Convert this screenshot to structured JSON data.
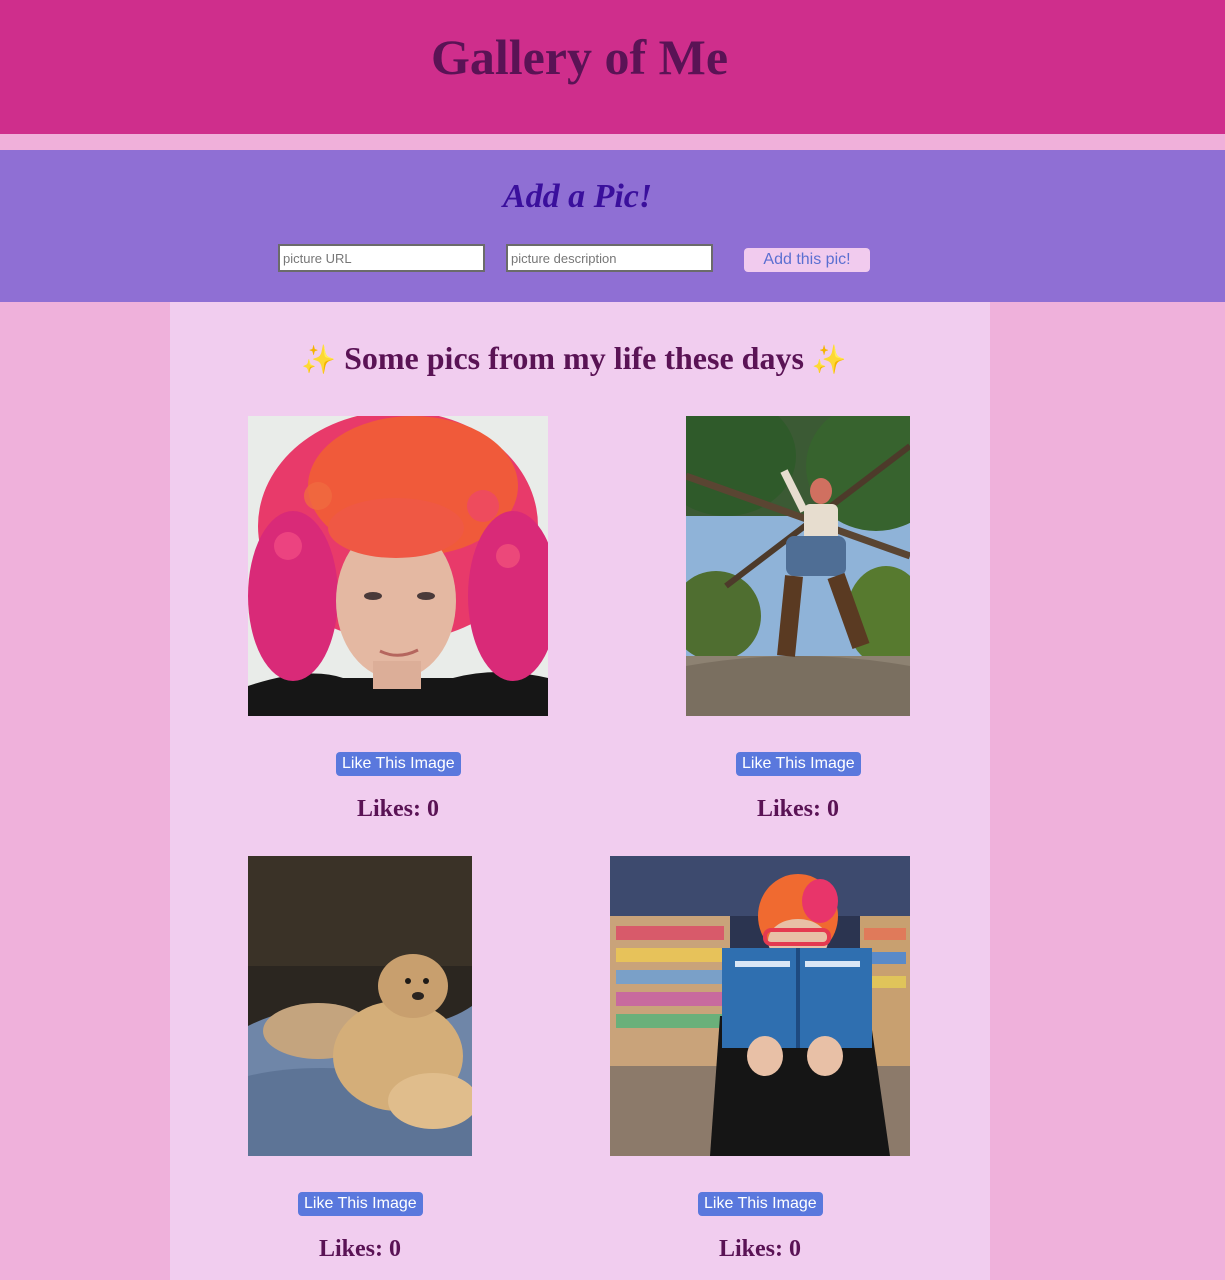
{
  "header": {
    "title": "Gallery of Me"
  },
  "add_form": {
    "heading": "Add a Pic!",
    "url_placeholder": "picture URL",
    "description_placeholder": "picture description",
    "submit_label": "Add this pic!"
  },
  "gallery": {
    "sparkle_left": "✨",
    "title": "Some pics from my life these days",
    "sparkle_right": "✨",
    "like_button_label": "Like This Image",
    "items": [
      {
        "likes_text": "Likes: 0"
      },
      {
        "likes_text": "Likes: 0"
      },
      {
        "likes_text": "Likes: 0"
      },
      {
        "likes_text": "Likes: 0"
      }
    ]
  },
  "colors": {
    "header_bg": "#cf2e8c",
    "title_text": "#5a1355",
    "form_bg": "#8f6fd4",
    "form_heading": "#3a0f9c",
    "page_bg": "#efb1db",
    "main_bg": "#f1cdef",
    "like_button": "#5a78dd",
    "add_button_bg": "#f1cbee",
    "add_button_text": "#5b6fd1"
  }
}
